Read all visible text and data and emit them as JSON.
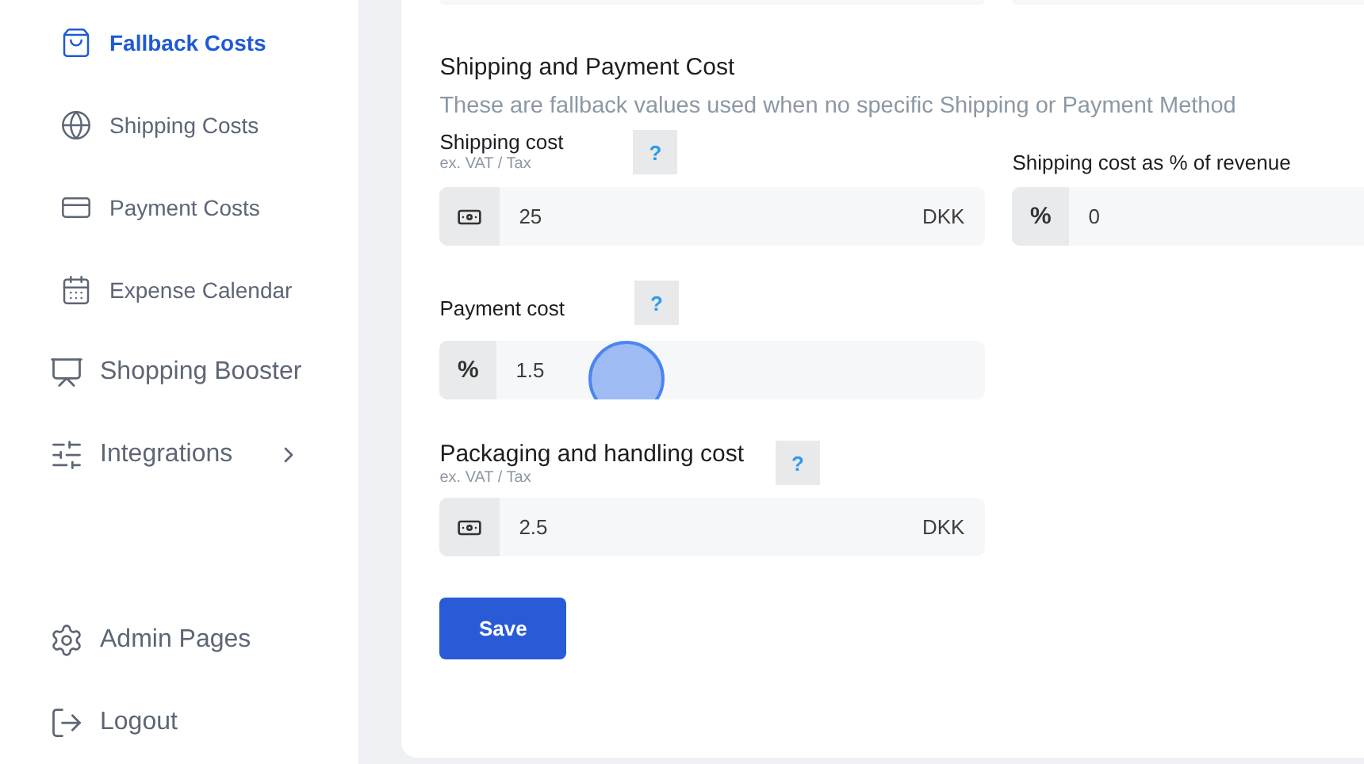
{
  "sidebar": {
    "items": [
      {
        "label": "Fallback Costs",
        "kind": "sub",
        "selected": true,
        "has_submenu": false
      },
      {
        "label": "Shipping Costs",
        "kind": "sub",
        "selected": false,
        "has_submenu": false
      },
      {
        "label": "Payment Costs",
        "kind": "sub",
        "selected": false,
        "has_submenu": false
      },
      {
        "label": "Expense Calendar",
        "kind": "sub",
        "selected": false,
        "has_submenu": false
      },
      {
        "label": "Shopping Booster",
        "kind": "main",
        "selected": false,
        "has_submenu": false
      },
      {
        "label": "Integrations",
        "kind": "main",
        "selected": false,
        "has_submenu": true
      }
    ],
    "footer_items": [
      {
        "label": "Admin Pages"
      },
      {
        "label": "Logout"
      }
    ]
  },
  "section": {
    "title": "Shipping and Payment Cost",
    "description": "These are fallback values used when no specific Shipping or Payment Method",
    "fields": [
      {
        "kind": "currency",
        "label": "Shipping cost",
        "hint": "ex. VAT / Tax",
        "help": "?",
        "value": "25",
        "suffix": "DKK"
      },
      {
        "kind": "percent",
        "label": "Shipping cost as % of revenue",
        "prefix": "%",
        "value": "0"
      },
      {
        "kind": "percent",
        "label": "Payment cost",
        "help": "?",
        "prefix": "%",
        "value": "1.5"
      },
      {
        "kind": "currency",
        "label": "Packaging and handling cost",
        "hint": "ex. VAT / Tax",
        "help": "?",
        "value": "2.5",
        "suffix": "DKK"
      }
    ],
    "save_button": "Save"
  }
}
